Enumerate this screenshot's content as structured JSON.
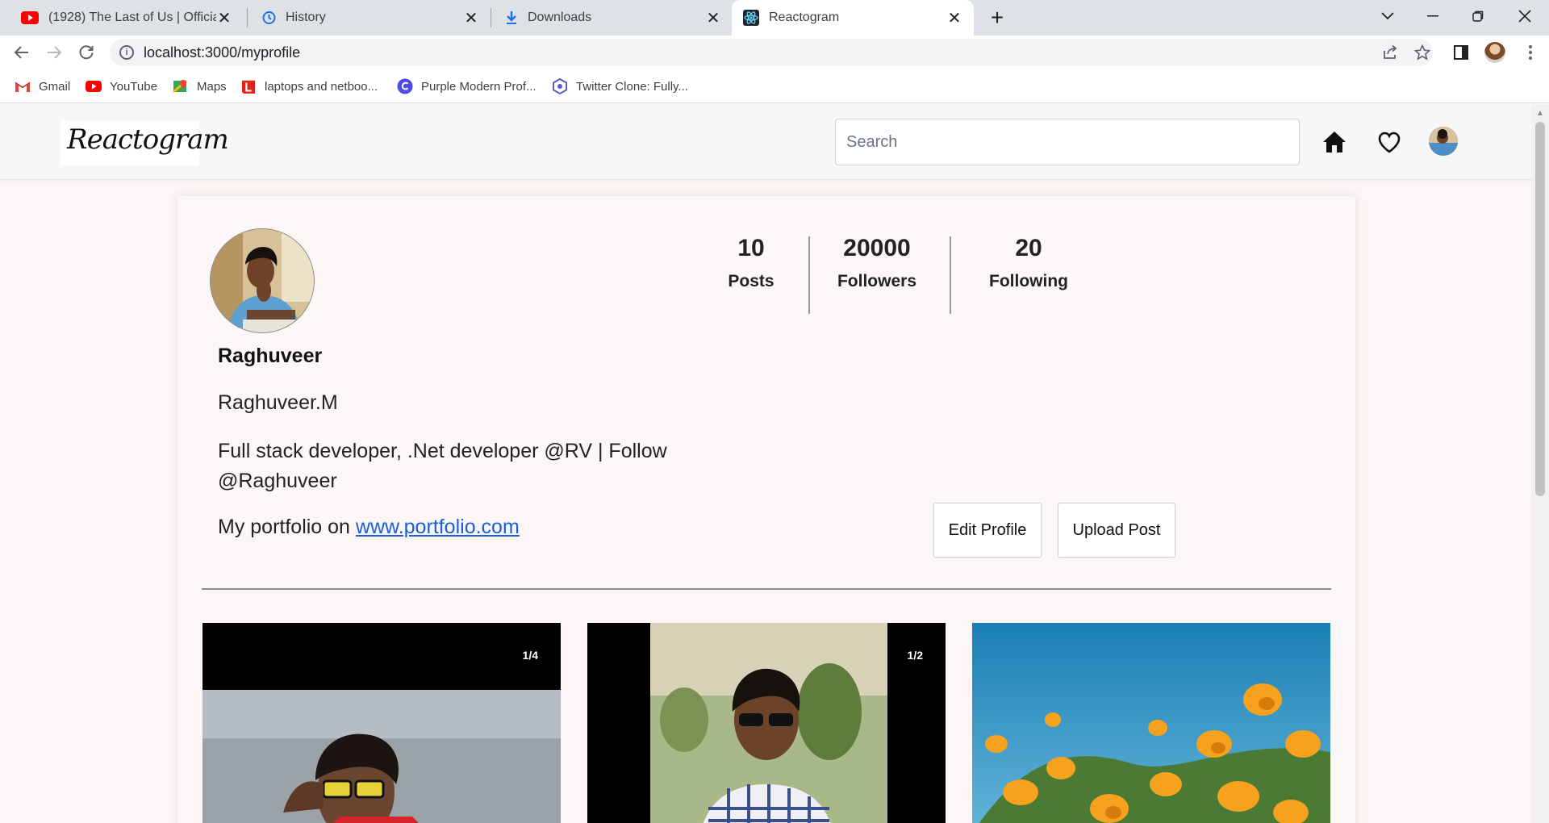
{
  "browser": {
    "tabs": [
      {
        "title": "(1928) The Last of Us | Official Tra",
        "icon": "youtube-icon",
        "active": false
      },
      {
        "title": "History",
        "icon": "history-icon",
        "active": false
      },
      {
        "title": "Downloads",
        "icon": "download-icon",
        "active": false
      },
      {
        "title": "Reactogram",
        "icon": "react-icon",
        "active": true
      }
    ],
    "close_glyph": "✕",
    "new_tab_glyph": "+",
    "url": "localhost:3000/myprofile",
    "bookmarks": [
      {
        "label": "Gmail",
        "icon": "gmail-icon"
      },
      {
        "label": "YouTube",
        "icon": "youtube-icon"
      },
      {
        "label": "Maps",
        "icon": "maps-icon"
      },
      {
        "label": "laptops and netboo...",
        "icon": "lenovo-icon"
      },
      {
        "label": "Purple Modern Prof...",
        "icon": "canva-icon"
      },
      {
        "label": "Twitter Clone: Fully...",
        "icon": "bookmark-site-icon"
      }
    ]
  },
  "app": {
    "logo": "Reactogram",
    "search_placeholder": "Search",
    "nav_icons": [
      "home-icon",
      "heart-icon",
      "avatar"
    ]
  },
  "profile": {
    "stats": [
      {
        "value": "10",
        "label": "Posts"
      },
      {
        "value": "20000",
        "label": "Followers"
      },
      {
        "value": "20",
        "label": "Following"
      }
    ],
    "username": "Raghuveer",
    "full_name": "Raghuveer.M",
    "bio": "Full stack developer, .Net developer @RV | Follow @Raghuveer",
    "portfolio_prefix": "My portfolio on",
    "portfolio_link": "www.portfolio.com",
    "edit_label": "Edit Profile",
    "upload_label": "Upload Post"
  },
  "posts": [
    {
      "badge": "1/4"
    },
    {
      "badge": "1/2"
    },
    {
      "badge": ""
    }
  ],
  "colors": {
    "page_bg": "#fcf7f6",
    "link": "#1a5ed8",
    "tabstrip": "#dee1e6"
  }
}
